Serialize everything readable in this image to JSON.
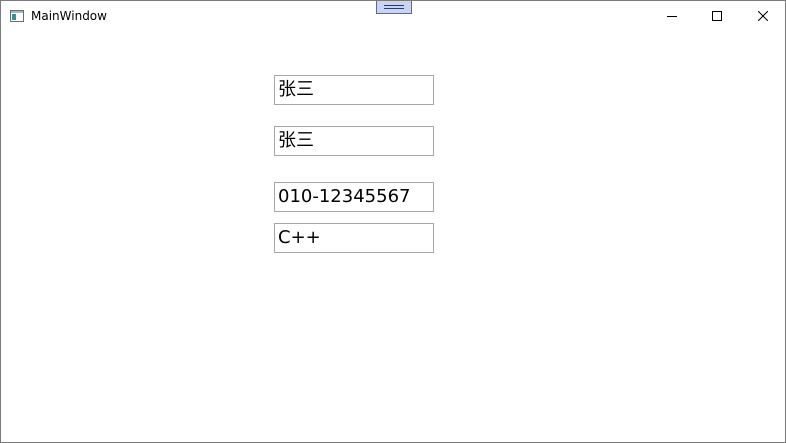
{
  "window": {
    "title": "MainWindow",
    "icons": {
      "app": "app-window-icon",
      "minimize": "minimize-icon",
      "maximize": "maximize-icon",
      "close": "close-icon"
    }
  },
  "fields": {
    "name1": "张三",
    "name2": "张三",
    "phone": "010-12345567",
    "language": "C++"
  }
}
